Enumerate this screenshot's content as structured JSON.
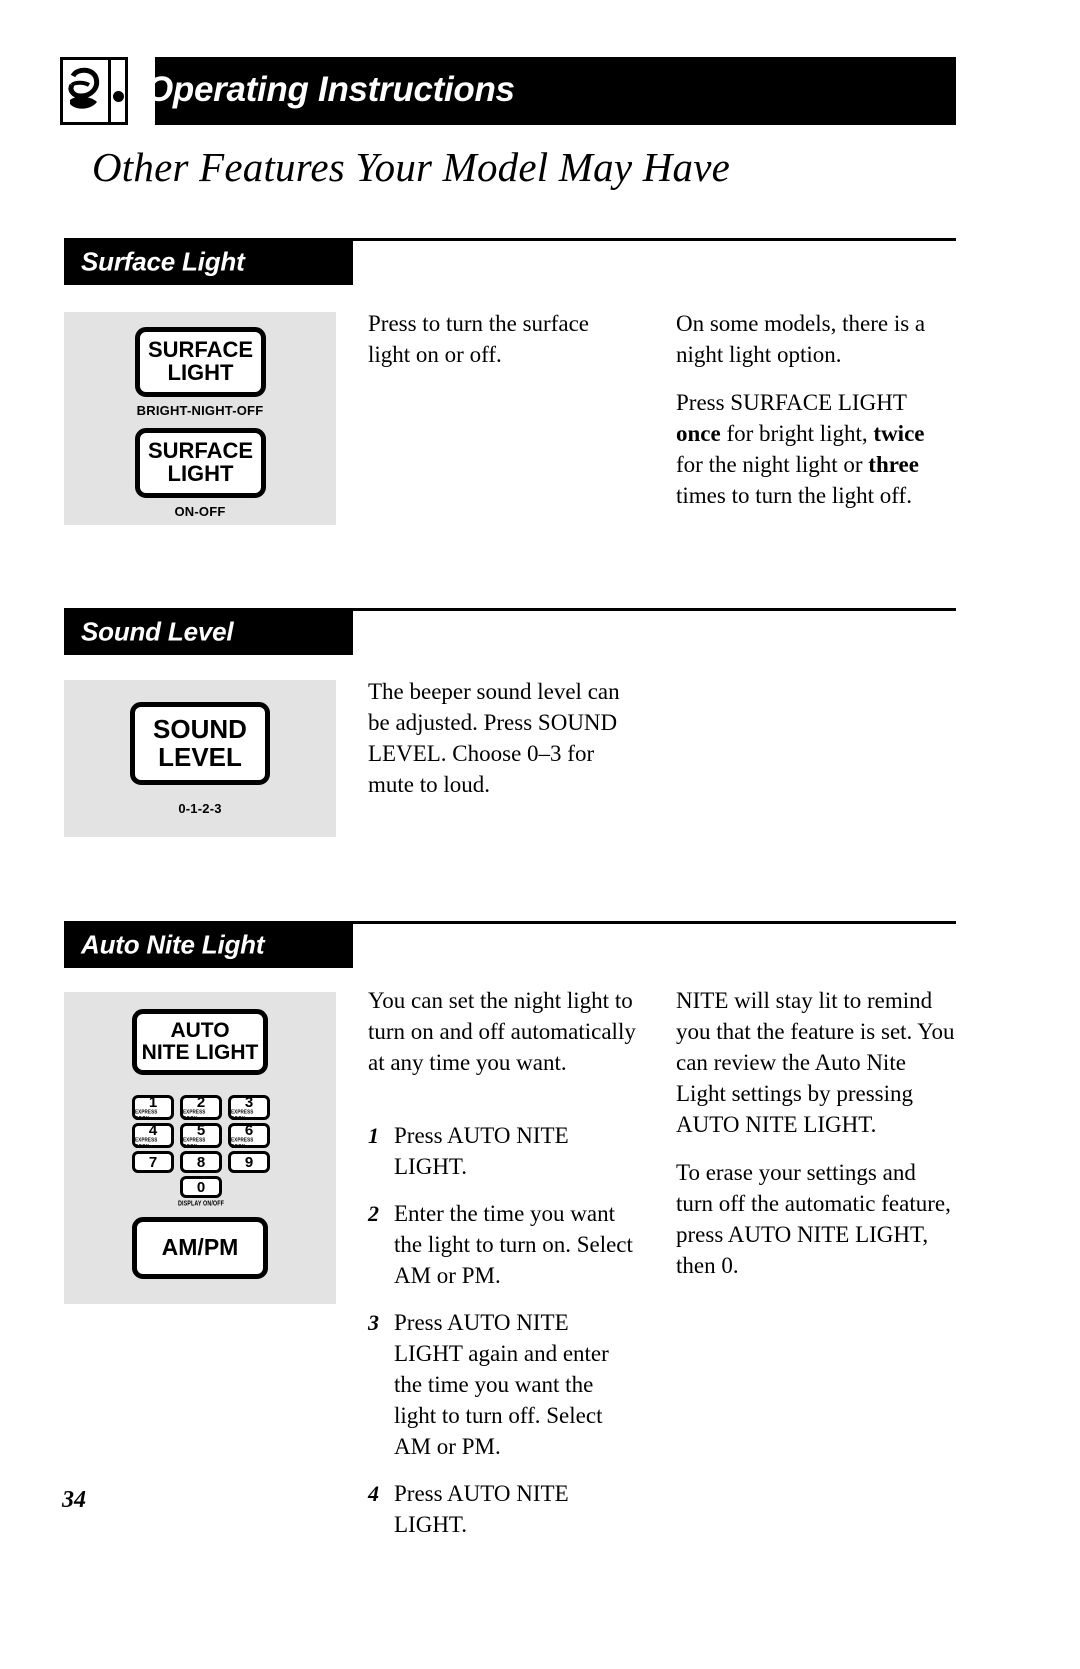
{
  "masthead": {
    "title": "Operating Instructions",
    "logo_icon": "ge-monogram-icon"
  },
  "page_heading": "Other Features Your Model May Have",
  "page_number": "34",
  "sections": [
    {
      "id": "surface-light",
      "tab_label": "Surface Light",
      "panel": {
        "keys": [
          {
            "lines": [
              "SURFACE",
              "LIGHT"
            ],
            "caption": "BRIGHT-NIGHT-OFF"
          },
          {
            "lines": [
              "SURFACE",
              "LIGHT"
            ],
            "caption": "ON-OFF"
          }
        ]
      },
      "column_middle": [
        "Press to turn the surface light on or off."
      ],
      "column_right": [
        "On some models, there is a night light option."
      ],
      "column_right_rich": {
        "lead": "Press SURFACE LIGHT ",
        "b1": "once",
        "mid1": " for bright light, ",
        "b2": "twice",
        "mid2": " for the night light or ",
        "b3": "three",
        "tail": " times to turn the light off."
      }
    },
    {
      "id": "sound-level",
      "tab_label": "Sound Level",
      "panel": {
        "keys": [
          {
            "lines": [
              "SOUND",
              "LEVEL"
            ],
            "caption": "0-1-2-3"
          }
        ]
      },
      "column_middle": [
        "The beeper sound level can be adjusted. Press SOUND LEVEL. Choose 0–3 for mute to loud."
      ],
      "column_right": []
    },
    {
      "id": "auto-nite-light",
      "tab_label": "Auto Nite Light",
      "panel": {
        "keys": [
          {
            "lines": [
              "AUTO",
              "NITE LIGHT"
            ],
            "caption": ""
          },
          {
            "lines": [
              "AM/PM"
            ],
            "caption": ""
          }
        ],
        "numpad": {
          "keys": [
            {
              "digit": "1",
              "sub": "EXPRESS COOK"
            },
            {
              "digit": "2",
              "sub": "EXPRESS COOK"
            },
            {
              "digit": "3",
              "sub": "EXPRESS COOK"
            },
            {
              "digit": "4",
              "sub": "EXPRESS COOK"
            },
            {
              "digit": "5",
              "sub": "EXPRESS COOK"
            },
            {
              "digit": "6",
              "sub": "EXPRESS COOK"
            },
            {
              "digit": "7",
              "sub": ""
            },
            {
              "digit": "8",
              "sub": ""
            },
            {
              "digit": "9",
              "sub": ""
            }
          ],
          "zero_key": {
            "digit": "0",
            "sub": ""
          },
          "zero_caption": "DISPLAY ON/OFF"
        }
      },
      "column_middle_intro": "You can set the night light to turn on and off automatically at any time you want.",
      "steps": [
        {
          "num": "1",
          "text": "Press AUTO NITE LIGHT."
        },
        {
          "num": "2",
          "text": "Enter the time you want the light to turn on. Select AM or PM."
        },
        {
          "num": "3",
          "text": "Press AUTO NITE LIGHT again and enter the time you want the light to turn off. Select AM or PM."
        },
        {
          "num": "4",
          "text": "Press AUTO NITE LIGHT."
        }
      ],
      "column_right": [
        "NITE will stay lit to remind you that the feature is set. You can review the Auto Nite Light settings by pressing AUTO NITE LIGHT.",
        "To erase your settings and turn off the automatic feature, press AUTO NITE LIGHT, then 0."
      ]
    }
  ],
  "colors": {
    "ink": "#000000",
    "panel_fill": "#e3e3e3",
    "paper": "#ffffff"
  }
}
